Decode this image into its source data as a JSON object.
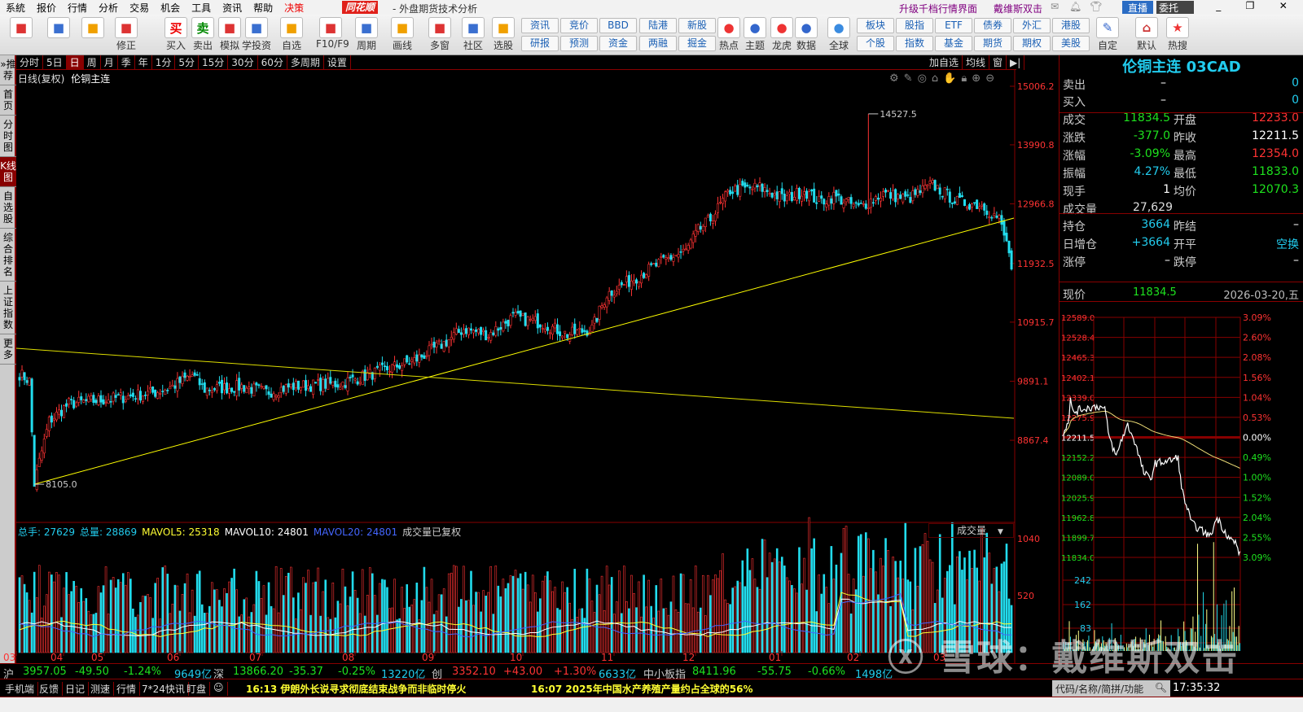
{
  "menu": {
    "items": [
      "系統",
      "报价",
      "行情",
      "分析",
      "交易",
      "机会",
      "工具",
      "资讯",
      "帮助",
      "决策"
    ],
    "logo": "同花顺",
    "title": "- 外盘期货技术分析",
    "upgrade": "升级千档行情界面",
    "user": "戴维斯双击",
    "live": "直播",
    "entrust": "委托"
  },
  "toolbar": {
    "icons": [
      {
        "label": "",
        "icon": "grid-icon"
      },
      {
        "label": "",
        "icon": "ai-icon"
      },
      {
        "label": "",
        "icon": "back-arrow-icon"
      },
      {
        "label": "修正",
        "icon": "correct-icon"
      },
      {
        "label": "买入",
        "icon": "buy-icon",
        "glyph": "买"
      },
      {
        "label": "卖出",
        "icon": "sell-icon",
        "glyph": "卖"
      },
      {
        "label": "模拟",
        "icon": "hammer-icon"
      },
      {
        "label": "学投资",
        "icon": "graduation-icon"
      },
      {
        "label": "自选",
        "icon": "favorites-icon"
      },
      {
        "label": "F10/F9",
        "icon": "f10-icon"
      },
      {
        "label": "周期",
        "icon": "clock-icon"
      },
      {
        "label": "画线",
        "icon": "pen-icon"
      },
      {
        "label": "多窗",
        "icon": "multiwindow-icon"
      },
      {
        "label": "社区",
        "icon": "community-icon"
      },
      {
        "label": "选股",
        "icon": "stock-picker-icon"
      }
    ],
    "buttons_top": [
      "资讯",
      "竞价",
      "BBD",
      "陆港",
      "新股"
    ],
    "buttons_bottom": [
      "研报",
      "预测",
      "资金",
      "两融",
      "掘金"
    ],
    "icons2": [
      {
        "label": "热点",
        "icon": "hot-icon"
      },
      {
        "label": "主题",
        "icon": "theme-icon"
      },
      {
        "label": "龙虎",
        "icon": "dragon-icon"
      },
      {
        "label": "数据",
        "icon": "pe-data-icon"
      },
      {
        "label": "全球",
        "icon": "globe-icon"
      }
    ],
    "buttons2_top": [
      "板块",
      "股指",
      "ETF",
      "债券",
      "外汇",
      "港股"
    ],
    "buttons2_bottom": [
      "个股",
      "指数",
      "基金",
      "期货",
      "期权",
      "美股"
    ],
    "icons3": [
      {
        "label": "自定",
        "icon": "custom-icon"
      },
      {
        "label": "默认",
        "icon": "home-icon"
      },
      {
        "label": "热搜",
        "icon": "hot-search-icon"
      }
    ]
  },
  "leftnav": [
    "»推荐",
    "首页",
    "分时图",
    "K线图",
    "自选股",
    "综合排名",
    "上证指数",
    "更多"
  ],
  "periods": [
    "分时",
    "5日",
    "日",
    "周",
    "月",
    "季",
    "年",
    "1分",
    "5分",
    "15分",
    "30分",
    "60分",
    "多周期",
    "设置"
  ],
  "active_period": "日",
  "right_tools": [
    "加自选",
    "均线",
    "窗",
    "▶|"
  ],
  "chart": {
    "title": "日线(复权)",
    "name": "伦铜主连",
    "high_label": "14527.5",
    "low_label": "8105.0",
    "price_ticks": [
      "15006.2",
      "13990.8",
      "12966.8",
      "11932.5",
      "10915.7",
      "9891.1",
      "8867.4"
    ],
    "months": [
      "03",
      "04",
      "05",
      "06",
      "07",
      "08",
      "09",
      "10",
      "11",
      "12",
      "01",
      "02",
      "03"
    ],
    "anchors": [
      [
        0,
        10020
      ],
      [
        4,
        9900
      ],
      [
        6,
        8105
      ],
      [
        8,
        8500
      ],
      [
        12,
        9200
      ],
      [
        20,
        9500
      ],
      [
        40,
        9600
      ],
      [
        55,
        9700
      ],
      [
        62,
        9800
      ],
      [
        70,
        10000
      ],
      [
        75,
        9750
      ],
      [
        90,
        9800
      ],
      [
        100,
        9700
      ],
      [
        110,
        9800
      ],
      [
        130,
        9850
      ],
      [
        145,
        10050
      ],
      [
        160,
        10250
      ],
      [
        172,
        10550
      ],
      [
        180,
        10800
      ],
      [
        190,
        10700
      ],
      [
        200,
        11000
      ],
      [
        212,
        10900
      ],
      [
        222,
        10700
      ],
      [
        232,
        10800
      ],
      [
        238,
        11400
      ],
      [
        250,
        11700
      ],
      [
        262,
        12000
      ],
      [
        270,
        12150
      ],
      [
        275,
        12500
      ],
      [
        280,
        12700
      ],
      [
        288,
        13200
      ],
      [
        300,
        13250
      ],
      [
        310,
        13050
      ],
      [
        318,
        13200
      ],
      [
        324,
        13000
      ],
      [
        330,
        13100
      ],
      [
        340,
        12900
      ],
      [
        350,
        13150
      ],
      [
        360,
        13050
      ],
      [
        370,
        13300
      ],
      [
        380,
        13000
      ],
      [
        390,
        12950
      ],
      [
        397,
        12700
      ],
      [
        402,
        12000
      ]
    ],
    "trend_lines": [
      {
        "from": [
          6,
          8105
        ],
        "to_price": 12720
      },
      {
        "start_price": 10463,
        "end_price": 9249
      }
    ]
  },
  "volume": {
    "legend": [
      {
        "t": "总手: 27629",
        "c": "#22ccee"
      },
      {
        "t": "总量: 28869",
        "c": "#22ccee"
      },
      {
        "t": "MAVOL5: 25318",
        "c": "#ffff33"
      },
      {
        "t": "MAVOL10: 24801",
        "c": "#ffffff"
      },
      {
        "t": "MAVOL20: 24801",
        "c": "#4466ff"
      },
      {
        "t": "成交量已复权",
        "c": "#cccccc"
      }
    ],
    "selector": "成交量",
    "ticks": [
      "1040",
      "520"
    ]
  },
  "quote": {
    "symbol": "伦铜主连 03CAD",
    "rows": [
      {
        "l": "卖出",
        "v": "–",
        "v2": "0"
      },
      {
        "l": "买入",
        "v": "–",
        "v2": "0"
      },
      {
        "l": "成交",
        "v": "11834.5",
        "l2": "开盘",
        "v2": "12233.0"
      },
      {
        "l": "涨跌",
        "v": "-377.0",
        "l2": "昨收",
        "v2": "12211.5"
      },
      {
        "l": "涨幅",
        "v": "-3.09%",
        "l2": "最高",
        "v2": "12354.0"
      },
      {
        "l": "振幅",
        "v": "4.27%",
        "l2": "最低",
        "v2": "11833.0"
      },
      {
        "l": "现手",
        "v": "1",
        "l2": "均价",
        "v2": "12070.3"
      },
      {
        "l": "成交量",
        "v": "27,629"
      },
      {
        "l": "持仓",
        "v": "3664",
        "l2": "昨结",
        "v2": "–"
      },
      {
        "l": "日增仓",
        "v": "+3664",
        "l2": "开平",
        "v2": "空换"
      },
      {
        "l": "涨停",
        "v": "–",
        "l2": "跌停",
        "v2": "–"
      }
    ],
    "now_label": "现价",
    "now_price": "11834.5",
    "date": "2026-03-20,五"
  },
  "intraday": {
    "price_ticks": [
      "12589.0",
      "12528.4",
      "12465.3",
      "12402.1",
      "12339.0",
      "12275.9",
      "12211.5",
      "12152.2",
      "12089.0",
      "12025.9",
      "11962.8",
      "11899.7",
      "11834.0"
    ],
    "pct_ticks": [
      "3.09%",
      "2.60%",
      "2.08%",
      "1.56%",
      "1.04%",
      "0.53%",
      "0.00%",
      "0.49%",
      "1.00%",
      "1.52%",
      "2.04%",
      "2.55%",
      "3.09%"
    ],
    "vol_ticks": [
      "242",
      "162",
      "83"
    ],
    "anchors": [
      [
        0,
        12230
      ],
      [
        4,
        12260
      ],
      [
        6,
        12330
      ],
      [
        8,
        12290
      ],
      [
        15,
        12300
      ],
      [
        30,
        12310
      ],
      [
        36,
        12300
      ],
      [
        40,
        12210
      ],
      [
        46,
        12150
      ],
      [
        50,
        12200
      ],
      [
        56,
        12250
      ],
      [
        62,
        12200
      ],
      [
        70,
        12100
      ],
      [
        76,
        12080
      ],
      [
        80,
        12130
      ],
      [
        95,
        12140
      ],
      [
        100,
        12150
      ],
      [
        103,
        12050
      ],
      [
        107,
        12000
      ],
      [
        112,
        11940
      ],
      [
        120,
        11920
      ],
      [
        128,
        11900
      ],
      [
        134,
        11960
      ],
      [
        140,
        11920
      ],
      [
        146,
        11890
      ],
      [
        150,
        11880
      ],
      [
        155,
        11834
      ]
    ]
  },
  "index_bar": [
    {
      "t": "沪",
      "c": "#ccc"
    },
    {
      "t": "3957.05",
      "c": "#1ee21e"
    },
    {
      "t": "-49.50",
      "c": "#1ee21e"
    },
    {
      "t": "-1.24%",
      "c": "#1ee21e"
    },
    {
      "t": "9649亿",
      "c": "#22ccee"
    },
    {
      "t": "深",
      "c": "#ccc"
    },
    {
      "t": "13866.20",
      "c": "#1ee21e"
    },
    {
      "t": "-35.37",
      "c": "#1ee21e"
    },
    {
      "t": "-0.25%",
      "c": "#1ee21e"
    },
    {
      "t": "13220亿",
      "c": "#22ccee"
    },
    {
      "t": "创",
      "c": "#ccc"
    },
    {
      "t": "3352.10",
      "c": "#ff3333"
    },
    {
      "t": "+43.00",
      "c": "#ff3333"
    },
    {
      "t": "+1.30%",
      "c": "#ff3333"
    },
    {
      "t": "6633亿",
      "c": "#22ccee"
    },
    {
      "t": "中小板指",
      "c": "#ccc"
    },
    {
      "t": "8411.96",
      "c": "#1ee21e"
    },
    {
      "t": "-55.75",
      "c": "#1ee21e"
    },
    {
      "t": "-0.66%",
      "c": "#1ee21e"
    },
    {
      "t": "1498亿",
      "c": "#22ccee"
    }
  ],
  "bottom": {
    "tabs": [
      "手机端",
      "反馈",
      "日记",
      "测速",
      "行情",
      "7*24快讯",
      "盯盘"
    ],
    "news1": "16:13 伊朗外长说寻求彻底结束战争而非临时停火",
    "news2": "16:07 2025年中国水产养殖产量约占全球的56%",
    "search_placeholder": "代码/名称/简拼/功能",
    "clock": "17:35:32"
  },
  "watermark": "雪球：戴维斯双击"
}
